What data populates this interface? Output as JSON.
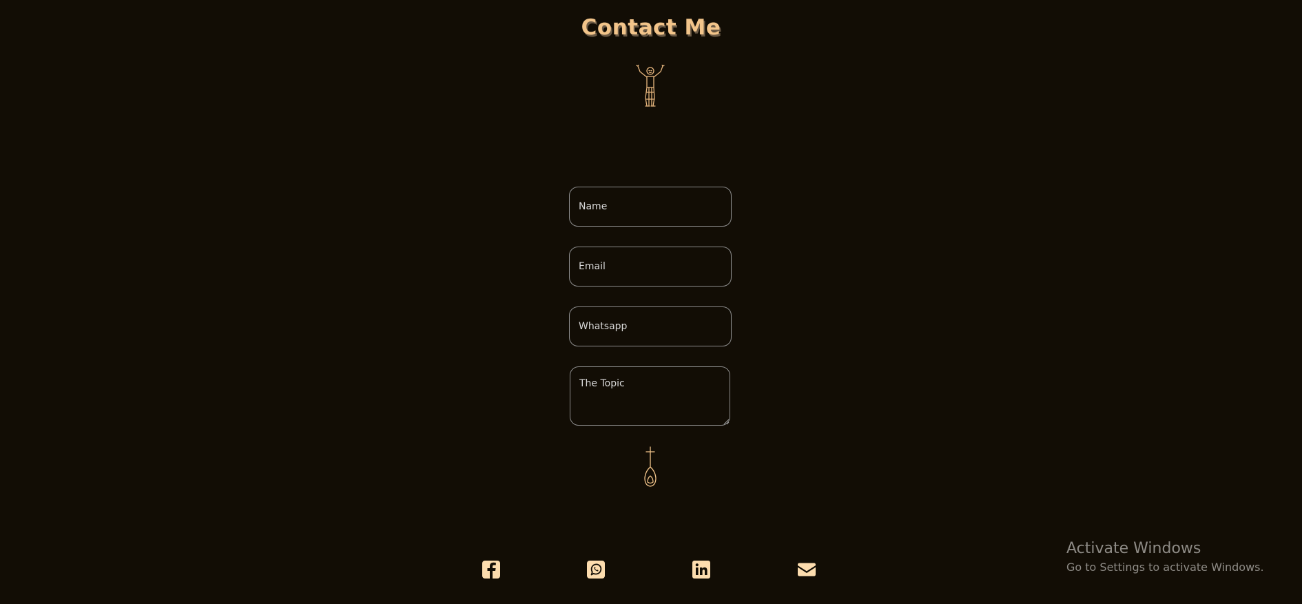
{
  "header": {
    "title": "Contact Me"
  },
  "form": {
    "name": {
      "placeholder": "Name",
      "value": ""
    },
    "email": {
      "placeholder": "Email",
      "value": ""
    },
    "whatsapp": {
      "placeholder": "Whatsapp",
      "value": ""
    },
    "topic": {
      "placeholder": "The Topic",
      "value": ""
    }
  },
  "icons": {
    "header_figure": "person-arms-raised-icon",
    "send": "sword-send-icon",
    "facebook": "facebook-icon",
    "whatsapp": "whatsapp-icon",
    "linkedin": "linkedin-icon",
    "email": "envelope-icon"
  },
  "colors": {
    "background": "#120d05",
    "accent": "#f2c48a",
    "title_shadow": "#6b5a46",
    "field_border": "#8d8d8d",
    "icon": "#fcdcae"
  },
  "watermark": {
    "title": "Activate Windows",
    "subtitle": "Go to Settings to activate Windows."
  }
}
